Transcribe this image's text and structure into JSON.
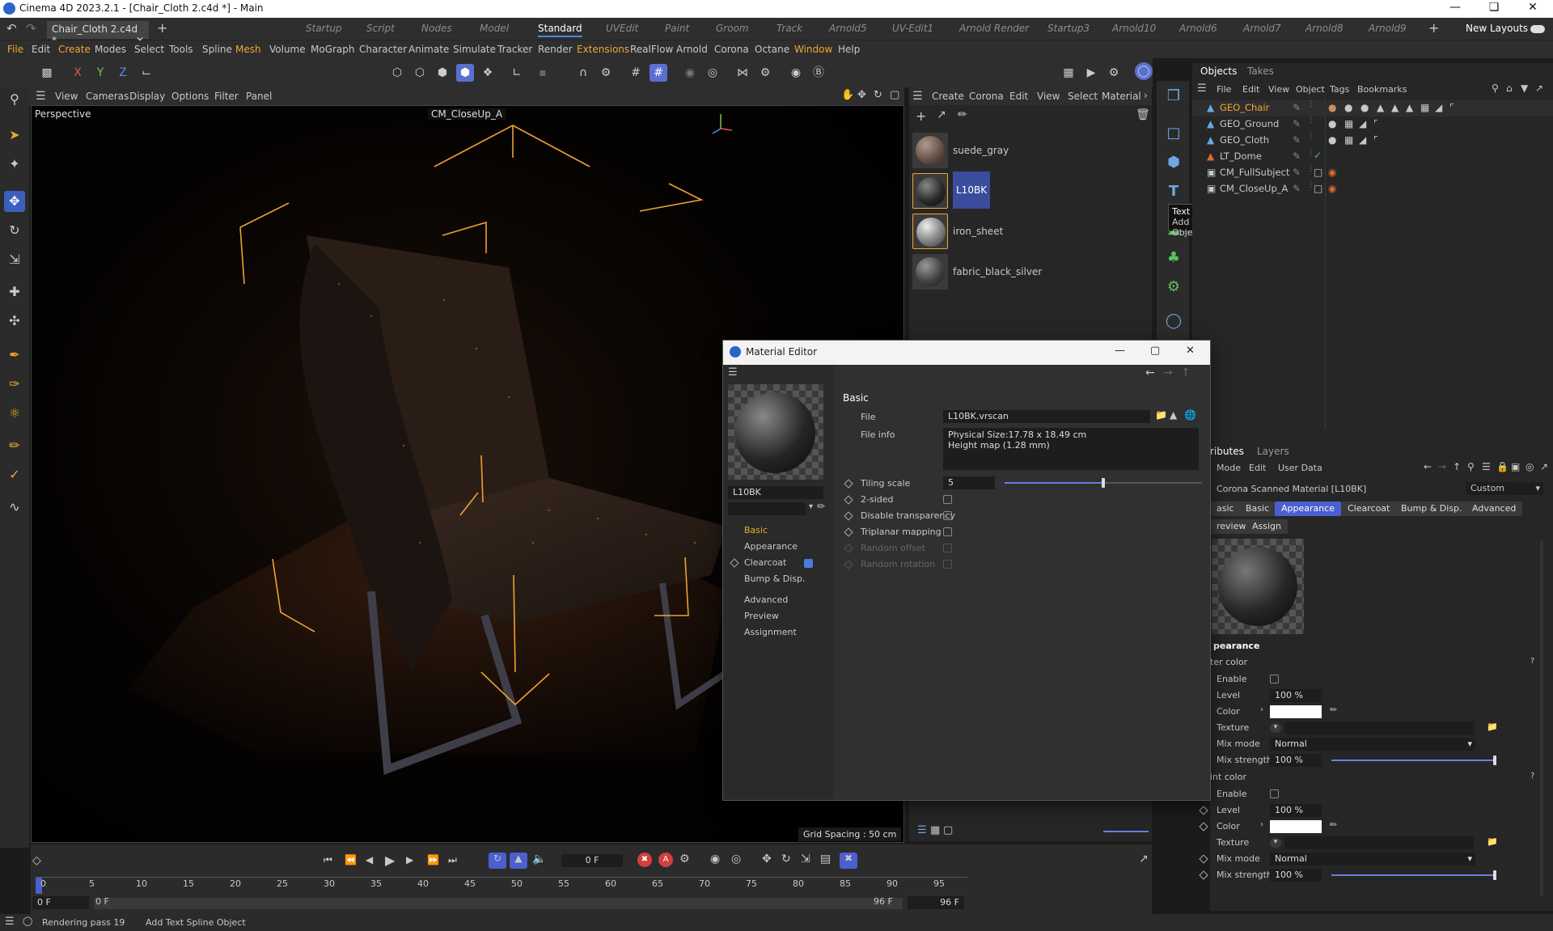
{
  "window": {
    "title": "Cinema 4D 2023.2.1 - [Chair_Cloth 2.c4d *] - Main"
  },
  "tabs": {
    "file_tab": "Chair_Cloth 2.c4d *",
    "layouts": [
      "Startup",
      "Script",
      "Nodes",
      "Model",
      "Standard",
      "UVEdit",
      "Paint",
      "Groom",
      "Track",
      "Arnold5",
      "UV-Edit1",
      "Arnold Render",
      "Startup3",
      "Arnold10",
      "Arnold6",
      "Arnold7",
      "Arnold8",
      "Arnold9"
    ],
    "active_layout": "Standard",
    "new_layouts": "New Layouts"
  },
  "menu": [
    "File",
    "Edit",
    "Create",
    "Modes",
    "Select",
    "Tools",
    "Spline",
    "Mesh",
    "Volume",
    "MoGraph",
    "Character",
    "Animate",
    "Simulate",
    "Tracker",
    "Render",
    "Extensions",
    "RealFlow",
    "Arnold",
    "Corona",
    "Octane",
    "Window",
    "Help"
  ],
  "toolbar": {
    "axes": [
      "X",
      "Y",
      "Z"
    ]
  },
  "viewport": {
    "menu": [
      "View",
      "Cameras",
      "Display",
      "Options",
      "Filter",
      "Panel"
    ],
    "label": "Perspective",
    "camera": "CM_CloseUp_A",
    "grid_spacing": "Grid Spacing : 50 cm"
  },
  "material_manager": {
    "menu": [
      "Create",
      "Corona",
      "Edit",
      "View",
      "Select",
      "Material"
    ],
    "materials": [
      {
        "name": "suede_gray",
        "color": "#7a6a60"
      },
      {
        "name": "L10BK",
        "color": "#2a2a2a"
      },
      {
        "name": "iron_sheet",
        "color": "#9a9a9a"
      },
      {
        "name": "fabric_black_silver",
        "color": "#4a4a4a"
      }
    ],
    "selected": "L10BK"
  },
  "tooltip": {
    "title": "Text Spline",
    "desc": "Add Text Spline Object"
  },
  "objects": {
    "tabs": [
      "Objects",
      "Takes"
    ],
    "menu": [
      "File",
      "Edit",
      "View",
      "Object",
      "Tags",
      "Bookmarks"
    ],
    "items": [
      {
        "name": "GEO_Chair",
        "selected": true
      },
      {
        "name": "GEO_Ground",
        "selected": false
      },
      {
        "name": "GEO_Cloth",
        "selected": false
      },
      {
        "name": "LT_Dome",
        "selected": false
      },
      {
        "name": "CM_FullSubject",
        "selected": false
      },
      {
        "name": "CM_CloseUp_A",
        "selected": false
      }
    ]
  },
  "material_editor": {
    "title": "Material Editor",
    "material_name": "L10BK",
    "nav": [
      "Basic",
      "Appearance",
      "Clearcoat",
      "Bump & Disp.",
      "Advanced",
      "Preview",
      "Assignment"
    ],
    "section": "Basic",
    "file_label": "File",
    "file_value": "L10BK.vrscan",
    "fileinfo_label": "File info",
    "fileinfo_line1": "Physical Size:17.78 x 18.49 cm",
    "fileinfo_line2": "Height map (1.28 mm)",
    "tiling_label": "Tiling scale",
    "tiling_value": "5",
    "tiling_fraction": 0.5,
    "params": [
      "2-sided",
      "Disable transparency",
      "Triplanar mapping",
      "Random offset",
      "Random rotation"
    ]
  },
  "attributes": {
    "tabs": [
      "ributes",
      "Layers"
    ],
    "menu": [
      "Mode",
      "Edit",
      "User Data"
    ],
    "object_title": "Corona Scanned Material [L10BK]",
    "preset": "Custom",
    "buttons": [
      "asic",
      "Basic",
      "Appearance",
      "Clearcoat",
      "Bump & Disp.",
      "Advanced"
    ],
    "active_button": "Appearance",
    "buttons2": [
      "review",
      "Assign"
    ],
    "section": "pearance",
    "group1": "ter color",
    "group2": "int color",
    "enable": "Enable",
    "level": "Level",
    "level_value": "100 %",
    "color": "Color",
    "texture": "Texture",
    "mixmode": "Mix mode",
    "mixmode_value": "Normal",
    "mixstrength": "Mix strength",
    "mixstrength_value": "100 %",
    "help": "?"
  },
  "timeline": {
    "current_frame": "0 F",
    "ticks": [
      "0",
      "5",
      "10",
      "15",
      "20",
      "25",
      "30",
      "35",
      "40",
      "45",
      "50",
      "55",
      "60",
      "65",
      "70",
      "75",
      "80",
      "85",
      "90",
      "95"
    ],
    "start": "0 F",
    "start2": "0 F",
    "end": "96 F",
    "end2": "96 F"
  },
  "status": {
    "render": "Rendering pass 19",
    "hint": "Add Text Spline Object"
  }
}
